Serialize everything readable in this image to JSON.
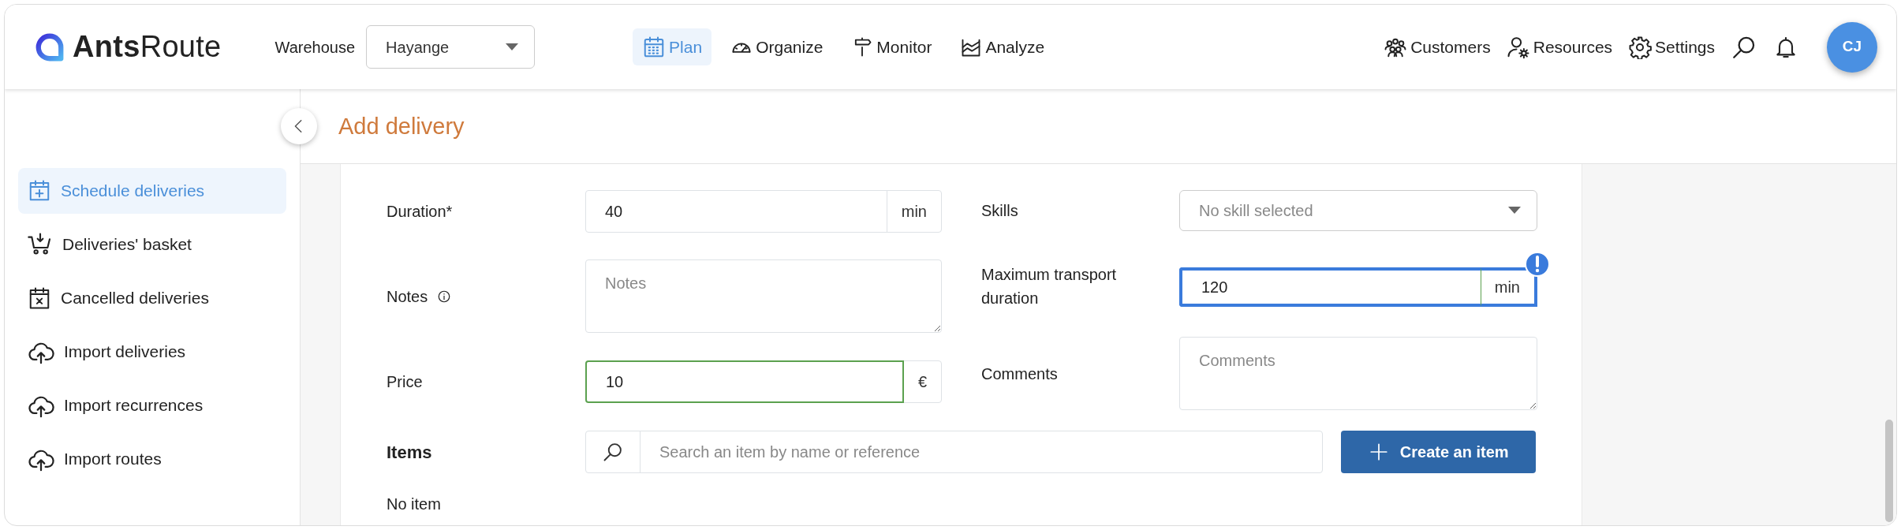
{
  "header": {
    "logo": "**Ants**Route",
    "warehouse_label": "Warehouse",
    "warehouse_select": {
      "value": "Hayange"
    },
    "nav": [
      {
        "label": "Plan",
        "selected": true
      },
      {
        "label": "Organize",
        "selected": false
      },
      {
        "label": "Monitor",
        "selected": false
      },
      {
        "label": "Analyze",
        "selected": false
      }
    ],
    "tools": [
      {
        "label": "Customers"
      },
      {
        "label": "Resources"
      },
      {
        "label": "Settings"
      }
    ],
    "avatar": "CJ"
  },
  "sidebar": {
    "items": [
      {
        "label": "Schedule deliveries",
        "selected": true
      },
      {
        "label": "Deliveries' basket",
        "selected": false
      },
      {
        "label": "Cancelled deliveries",
        "selected": false
      },
      {
        "label": "Import deliveries",
        "selected": false
      },
      {
        "label": "Import recurrences",
        "selected": false
      },
      {
        "label": "Import routes",
        "selected": false
      }
    ]
  },
  "page_title": "Add delivery",
  "form": {
    "left": [
      {
        "kind": "input",
        "label": "Duration*",
        "value": "40",
        "unit": "min",
        "valid": false,
        "highlighted": false
      },
      {
        "kind": "textarea",
        "label": "Notes",
        "info": true,
        "placeholder": "Notes"
      },
      {
        "kind": "input",
        "label": "Price",
        "value": "10",
        "unit": "€",
        "valid": true,
        "highlighted": false
      }
    ],
    "right": [
      {
        "kind": "select",
        "label": "Skills",
        "placeholder": "No skill selected"
      },
      {
        "kind": "input",
        "label": "Maximum transport duration",
        "value": "120",
        "unit": "min",
        "valid": true,
        "highlighted": true
      },
      {
        "kind": "textarea",
        "label": "Comments",
        "info": false,
        "placeholder": "Comments"
      }
    ]
  },
  "items": {
    "title": "Items",
    "search": {
      "placeholder": "Search an item by name or reference"
    },
    "create_button": "Create an item",
    "empty_text": "No item"
  }
}
